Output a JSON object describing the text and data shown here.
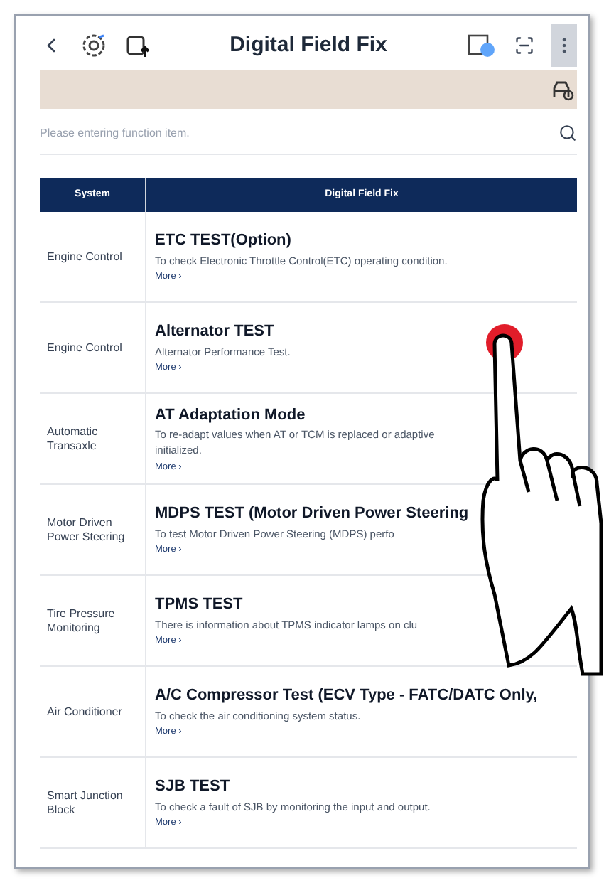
{
  "header": {
    "title": "Digital Field Fix"
  },
  "search": {
    "placeholder": "Please entering function item."
  },
  "table": {
    "columns": [
      "System",
      "Digital Field Fix"
    ],
    "rows": [
      {
        "system": "Engine Control",
        "title": "ETC TEST(Option)",
        "description": [
          "To check Electronic Throttle Control(ETC) operating condition."
        ],
        "more": "More ›"
      },
      {
        "system": "Engine Control",
        "title": "Alternator TEST",
        "description": [
          "Alternator Performance Test."
        ],
        "more": "More ›"
      },
      {
        "system": "Automatic Transaxle",
        "title": "AT Adaptation Mode",
        "description": [
          "To re-adapt values when AT or TCM is replaced or adaptive",
          "initialized."
        ],
        "more": "More ›"
      },
      {
        "system": "Motor Driven Power Steering",
        "title": "MDPS TEST (Motor Driven Power Steering",
        "description": [
          "To test Motor Driven Power Steering (MDPS) perfo"
        ],
        "more": "More ›"
      },
      {
        "system": "Tire Pressure Monitoring",
        "title": "TPMS TEST",
        "description": [
          "There is information about TPMS indicator lamps on clu"
        ],
        "more": "More ›"
      },
      {
        "system": "Air Conditioner",
        "title": "A/C Compressor Test (ECV Type - FATC/DATC Only,",
        "description": [
          "To check the air conditioning system status."
        ],
        "more": "More ›"
      },
      {
        "system": "Smart Junction Block",
        "title": "SJB TEST",
        "description": [
          "To check a fault of SJB by monitoring the input and output."
        ],
        "more": "More ›"
      }
    ]
  }
}
